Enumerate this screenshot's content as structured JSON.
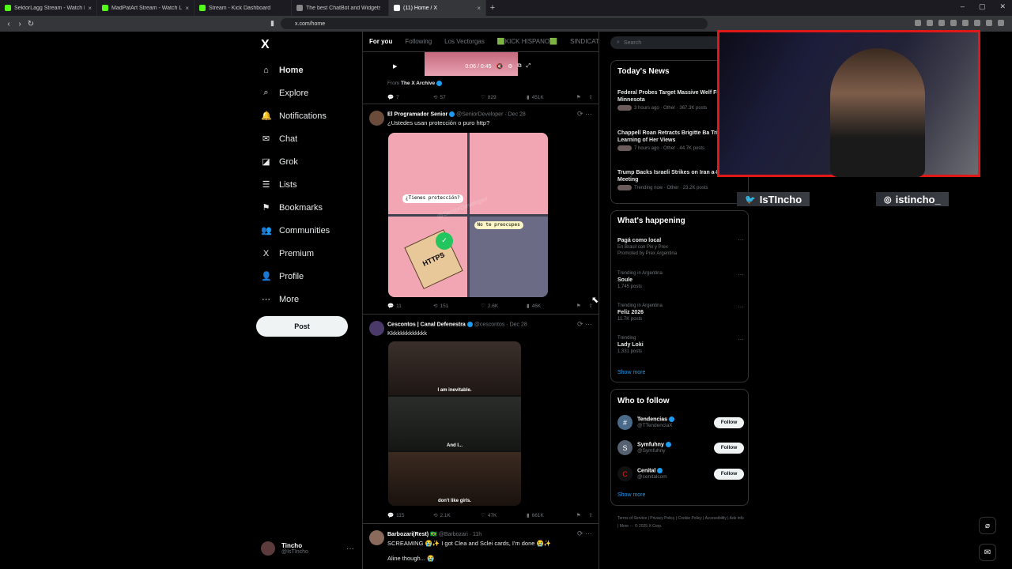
{
  "browser": {
    "tabs": [
      {
        "label": "SektorLagg Stream - Watch Live",
        "color": "#53fc18"
      },
      {
        "label": "MadPatArt Stream - Watch Live",
        "color": "#53fc18"
      },
      {
        "label": "Stream - Kick Dashboard",
        "color": "#53fc18"
      },
      {
        "label": "The best ChatBot and Widgets fo",
        "color": "#888888"
      },
      {
        "label": "(11) Home / X",
        "color": "#ffffff"
      }
    ],
    "new_tab": "+",
    "url": "x.com/home",
    "window_controls": [
      "–",
      "▢",
      "✕"
    ]
  },
  "x": {
    "logo": "X",
    "nav": [
      {
        "label": "Home",
        "icon": "⌂",
        "bold": true
      },
      {
        "label": "Explore",
        "icon": "⌕",
        "bold": false
      },
      {
        "label": "Notifications",
        "icon": "🔔",
        "bold": false
      },
      {
        "label": "Chat",
        "icon": "✉",
        "bold": false
      },
      {
        "label": "Grok",
        "icon": "◪",
        "bold": false
      },
      {
        "label": "Lists",
        "icon": "☰",
        "bold": false
      },
      {
        "label": "Bookmarks",
        "icon": "⚑",
        "bold": false
      },
      {
        "label": "Communities",
        "icon": "👥",
        "bold": false
      },
      {
        "label": "Premium",
        "icon": "X",
        "bold": false
      },
      {
        "label": "Profile",
        "icon": "👤",
        "bold": false
      },
      {
        "label": "More",
        "icon": "⋯",
        "bold": false
      }
    ],
    "post_button": "Post",
    "account": {
      "name": "Tincho",
      "handle": "@IsTIncho",
      "menu": "···"
    },
    "timeline_tabs": [
      "For you",
      "Following",
      "Los Vectorgas",
      "🟩KICK HISPANO🟩",
      "SINDICATO D"
    ],
    "video": {
      "time": "0:06 / 0:45"
    },
    "tweet0": {
      "from_label": "From",
      "from_name": "The X Archive",
      "replies": "7",
      "reposts": "57",
      "likes": "829",
      "views": "451K"
    },
    "tweet1": {
      "name": "El Programador Senior",
      "handle": "@SeniorDeveloper · Dec 28",
      "text": "¿Ustedes usan protección o puro http?",
      "comic": {
        "bubble1": "¿Tienes protección?",
        "bubble2": "No te preocupes",
        "box": "HTTPS",
        "watermark": "@SeniorDeveloper"
      },
      "replies": "11",
      "reposts": "151",
      "likes": "2.6K",
      "views": "46K"
    },
    "tweet2": {
      "name": "Cescontos | Canal Defenestra",
      "handle": "@cescontos · Dec 28",
      "text": "Kkkkkkkkkkkkk",
      "captions": [
        "I am inevitable.",
        "And I...",
        "don't like girls."
      ],
      "replies": "115",
      "reposts": "2.1K",
      "likes": "47K",
      "views": "661K"
    },
    "tweet3": {
      "name": "Barbozari(Rest) 🇧🇷",
      "handle": "@Barbozari · 11h",
      "text": "SCREAMING 😭✨ I got Clea and Sclei cards, I'm done 😭✨",
      "text2": "Aline though... 😭"
    },
    "search_placeholder": "Search",
    "todays_news": {
      "title": "Today's News",
      "items": [
        {
          "title": "Federal Probes Target Massive Welf Fraud in Minnesota",
          "meta": "3 hours ago · Other · 367.3K posts"
        },
        {
          "title": "Chappell Roan Retracts Brigitte Ba Tribute After Learning of Her Views",
          "meta": "7 hours ago · Other · 44.7K posts"
        },
        {
          "title": "Trump Backs Israeli Strikes on Iran a-Lago Meeting",
          "meta": "Trending now · Other · 23.2K posts"
        }
      ]
    },
    "whats_happening": {
      "title": "What's happening",
      "items": [
        {
          "category": "",
          "title": "Pagá como local",
          "sub1": "En Brasil con Pix y Prex",
          "sub2": "Promoted by Prex Argentina"
        },
        {
          "category": "Trending in Argentina",
          "title": "Soule",
          "sub1": "1,745 posts",
          "sub2": ""
        },
        {
          "category": "Trending in Argentina",
          "title": "Feliz 2026",
          "sub1": "11.7K posts",
          "sub2": ""
        },
        {
          "category": "Trending",
          "title": "Lady Loki",
          "sub1": "1,331 posts",
          "sub2": ""
        }
      ],
      "show_more": "Show more"
    },
    "who_to_follow": {
      "title": "Who to follow",
      "items": [
        {
          "name": "Tendencias",
          "handle": "@TTendenciaX",
          "initial": "#",
          "color": "#4a6a8a"
        },
        {
          "name": "Symfuhny",
          "handle": "@Symfuhny",
          "initial": "S",
          "color": "#556070"
        },
        {
          "name": "Cenital",
          "handle": "@cenitalcom",
          "initial": "C",
          "color": "#111111"
        }
      ],
      "follow_label": "Follow",
      "show_more": "Show more"
    },
    "footer": "Terms of Service | Privacy Policy | Cookie Policy | Accessibility | Ads info | More ··· © 2025 X Corp."
  },
  "overlay": {
    "twitter": "IsTIncho",
    "instagram": "istincho_",
    "border_color": "#e01818"
  }
}
